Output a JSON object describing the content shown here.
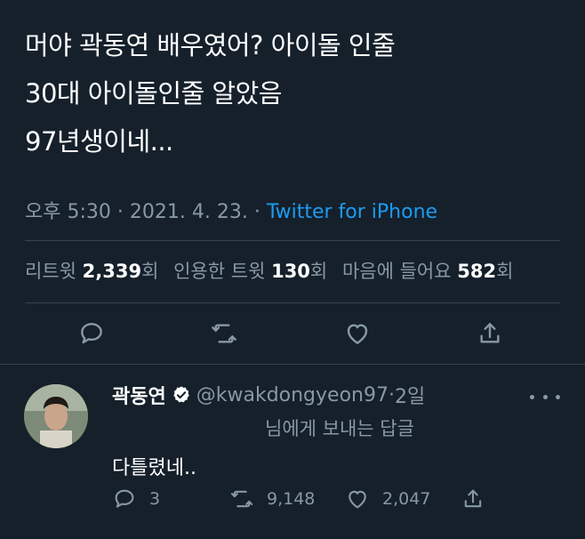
{
  "tweet": {
    "lines": [
      "머야 곽동연 배우였어? 아이돌 인줄",
      "30대 아이돌인줄 알았음",
      "97년생이네..."
    ],
    "time": "오후 5:30",
    "sep1": " · ",
    "date": "2021. 4. 23.",
    "sep2": " · ",
    "source": "Twitter for iPhone"
  },
  "stats": {
    "retweets_label": "리트윗",
    "retweets_count": "2,339",
    "retweets_unit": "회",
    "quotes_label": "인용한 트윗",
    "quotes_count": "130",
    "quotes_unit": "회",
    "likes_label": "마음에 들어요",
    "likes_count": "582",
    "likes_unit": "회"
  },
  "actions": [
    "reply",
    "retweet",
    "like",
    "share"
  ],
  "reply": {
    "name": "곽동연",
    "handle": "@kwakdongyeon97",
    "time_sep": " · ",
    "time": "2일",
    "reply_to": "님에게 보내는 답글",
    "body": "다틀렸네..",
    "reply_count": "3",
    "retweet_count": "9,148",
    "like_count": "2,047"
  },
  "colors": {
    "background": "#15202b",
    "muted": "#8899a6",
    "link": "#1d9bf0",
    "divider": "#38444d"
  }
}
